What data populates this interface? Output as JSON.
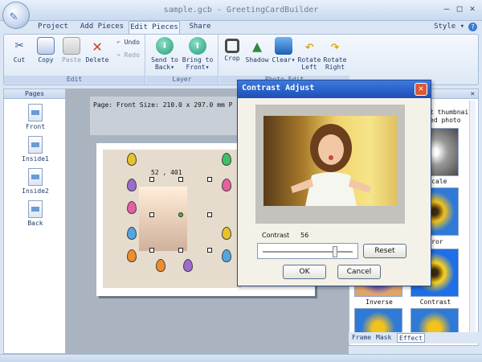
{
  "window": {
    "title": "sample.gcb - GreetingCardBuilder"
  },
  "tabs": [
    {
      "label": "Project"
    },
    {
      "label": "Add Pieces"
    },
    {
      "label": "Edit Pieces"
    },
    {
      "label": "Share"
    }
  ],
  "style_menu": "Style",
  "ribbon": {
    "edit": {
      "label": "Edit",
      "cut": "Cut",
      "copy": "Copy",
      "paste": "Paste",
      "delete": "Delete",
      "undo": "Undo",
      "redo": "Redo"
    },
    "layer": {
      "label": "Layer",
      "send_to_back_1": "Send to",
      "send_to_back_2": "Back",
      "bring_to_front_1": "Bring to",
      "bring_to_front_2": "Front"
    },
    "photo_edit": {
      "label": "Photo Edit",
      "crop": "Crop",
      "shadow": "Shadow",
      "clear_1": "Clear",
      "clear_2": "",
      "rotate_left_1": "Rotate",
      "rotate_left_2": "Left",
      "rotate_right_1": "Rotate",
      "rotate_right_2": "Right"
    }
  },
  "pages_panel": {
    "title": "Pages",
    "items": [
      {
        "label": "Front"
      },
      {
        "label": "Inside1"
      },
      {
        "label": "Inside2"
      },
      {
        "label": "Back"
      }
    ]
  },
  "canvas": {
    "info": "Page: Front   Size: 210.0 x 297.0 mm   P",
    "selection_label": "52 , 401"
  },
  "effect_panel": {
    "text_1": "t thumbnail",
    "text_2": "ed photo",
    "labels": {
      "grayscale": "yscale",
      "mirror": "rror",
      "inverse": "Inverse",
      "contrast": "Contrast"
    },
    "bottom_tabs": [
      {
        "label": "Frame"
      },
      {
        "label": "Mask"
      },
      {
        "label": "Effect"
      }
    ]
  },
  "dialog": {
    "title": "Contrast Adjust",
    "contrast_label": "Contrast",
    "contrast_value": "56",
    "contrast_level_percent": 56,
    "reset": "Reset",
    "ok": "OK",
    "cancel": "Cancel"
  }
}
